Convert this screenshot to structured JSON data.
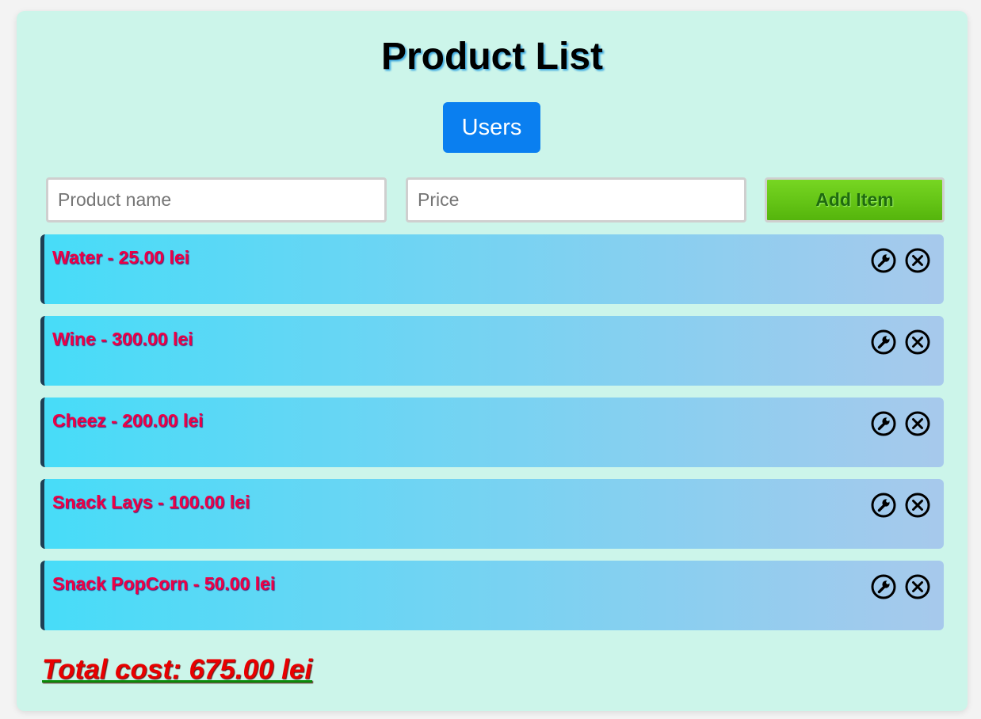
{
  "page": {
    "title": "Product List",
    "users_button": "Users"
  },
  "form": {
    "name_placeholder": "Product name",
    "name_value": "",
    "price_placeholder": "Price",
    "price_value": "",
    "add_label": "Add Item"
  },
  "items": [
    {
      "label": "Water - 25.00 lei"
    },
    {
      "label": "Wine - 300.00 lei"
    },
    {
      "label": "Cheez - 200.00 lei"
    },
    {
      "label": "Snack Lays - 100.00 lei"
    },
    {
      "label": "Snack PopCorn - 50.00 lei"
    }
  ],
  "total": {
    "label": "Total cost: 675.00 lei"
  },
  "icons": {
    "edit": "wrench-icon",
    "delete": "close-circle-icon"
  },
  "colors": {
    "users_button": "#0a7ff0",
    "add_button": "#66c518",
    "item_text": "#ee0045",
    "total_text": "#e80000",
    "card_background": "#ccf5ea"
  }
}
